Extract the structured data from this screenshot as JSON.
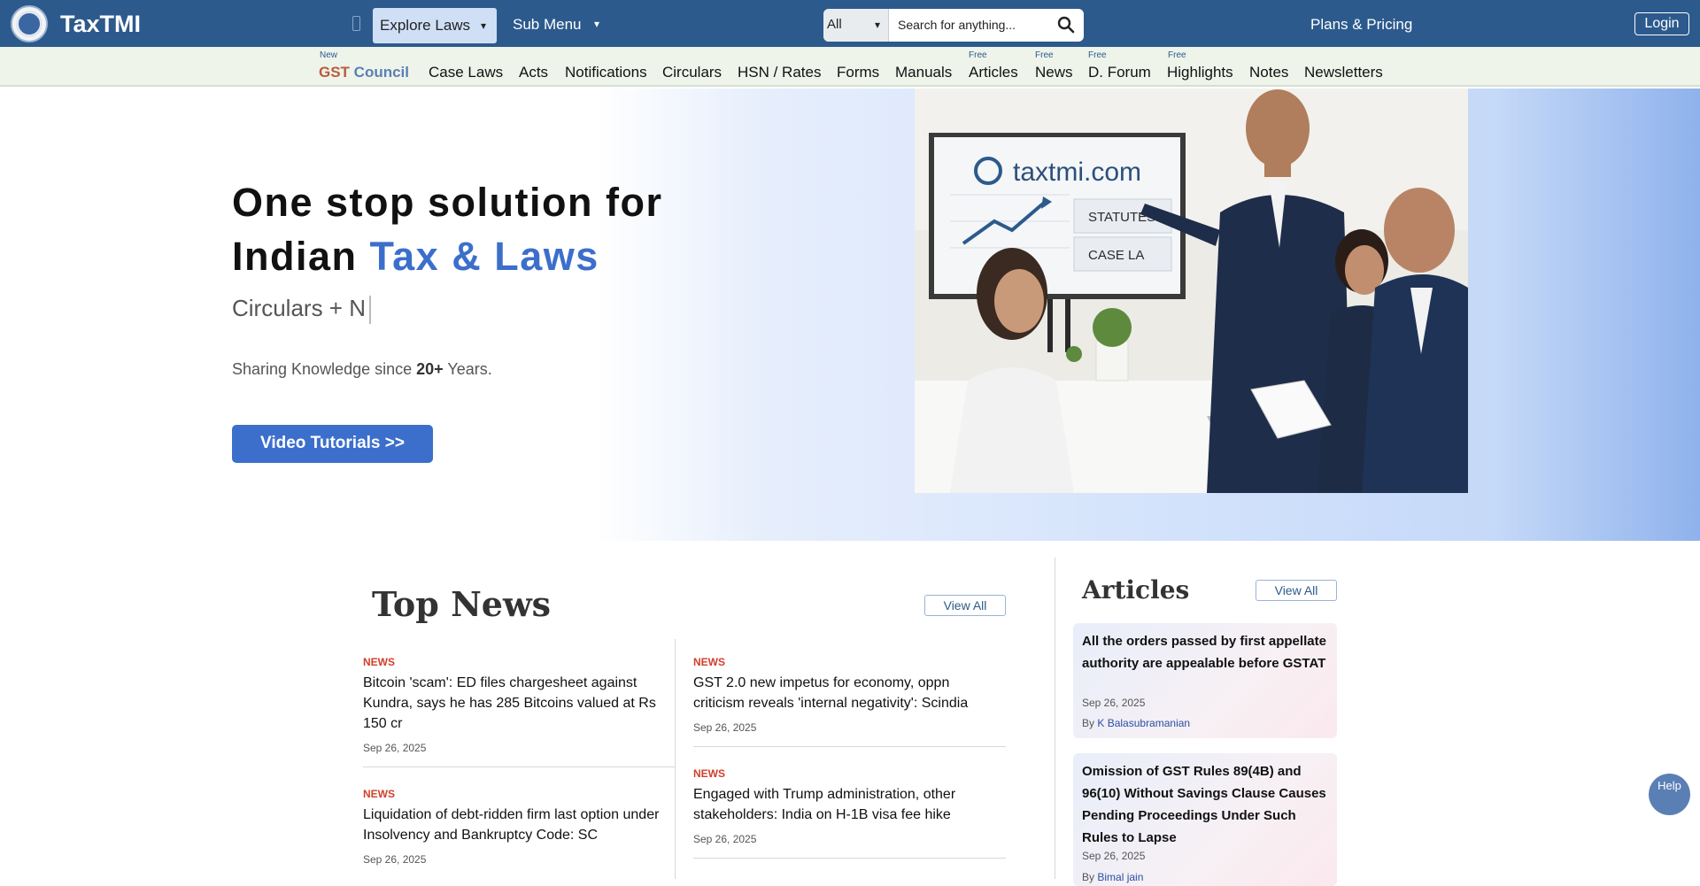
{
  "header": {
    "brand": "TaxTMI",
    "menu_glyph": "",
    "explore_label": "Explore Laws",
    "caret": "▾",
    "submenu_label": "Sub Menu",
    "search": {
      "scope": "All",
      "placeholder": "Search for anything..."
    },
    "plans_label": "Plans & Pricing ",
    "login_label": "Login"
  },
  "subnav": {
    "items": [
      {
        "tag": "New",
        "label": "GST Council",
        "accent_colors": [
          "#b85c3c",
          "#2c5a8c"
        ]
      },
      {
        "tag": "",
        "label": "Case Laws"
      },
      {
        "tag": "",
        "label": "Acts"
      },
      {
        "tag": "",
        "label": "Notifications"
      },
      {
        "tag": "",
        "label": "Circulars"
      },
      {
        "tag": "",
        "label": "HSN / Rates"
      },
      {
        "tag": "",
        "label": "Forms"
      },
      {
        "tag": "",
        "label": "Manuals"
      },
      {
        "tag": "Free",
        "label": "Articles"
      },
      {
        "tag": "Free",
        "label": "News"
      },
      {
        "tag": "Free",
        "label": "D. Forum"
      },
      {
        "tag": "Free",
        "label": "Highlights"
      },
      {
        "tag": "",
        "label": "Notes"
      },
      {
        "tag": "",
        "label": "Newsletters"
      }
    ]
  },
  "hero": {
    "line1": "One stop solution for",
    "line2_plain": "Indian ",
    "line2_accent": "Tax & Laws",
    "typed_text": "Circulars + N",
    "since_prefix": "Sharing Knowledge since ",
    "since_bold": "20+",
    "since_suffix": " Years.",
    "video_button": "Video Tutorials >>",
    "board_url": "taxtmi.com",
    "board_items": [
      "STATUTES",
      "CASE LA"
    ]
  },
  "top_news": {
    "title": "Top News",
    "view_all": "View All ",
    "items": [
      {
        "tag": " NEWS",
        "title": "Bitcoin 'scam': ED files chargesheet against Kundra, says he has 285 Bitcoins valued at Rs 150 cr",
        "date": "Sep 26, 2025"
      },
      {
        "tag": " NEWS",
        "title": "GST 2.0 new impetus for economy, oppn criticism reveals 'internal negativity': Scindia",
        "date": "Sep 26, 2025"
      },
      {
        "tag": " NEWS",
        "title": "Liquidation of debt-ridden firm last option under Insolvency and Bankruptcy Code: SC",
        "date": "Sep 26, 2025"
      },
      {
        "tag": " NEWS",
        "title": "Engaged with Trump administration, other stakeholders: India on H-1B visa fee hike",
        "date": "Sep 26, 2025"
      }
    ]
  },
  "articles": {
    "title": "Articles",
    "view_all": "View All ",
    "items": [
      {
        "title": "All the orders passed by first appellate authority are appealable before GSTAT",
        "date": "Sep 26, 2025",
        "by": "By",
        "author": "K Balasubramanian"
      },
      {
        "title": "Omission of GST Rules 89(4B) and 96(10) Without Savings Clause Causes Pending Proceedings Under Such Rules to Lapse",
        "date": "Sep 26, 2025",
        "by": "By",
        "author": "Bimal jain"
      }
    ]
  },
  "help": {
    "icon": "",
    "label": "Help"
  },
  "colors": {
    "topbar": "#2c5a8c",
    "accent": "#3c6fcb",
    "news_tag": "#d0402a"
  }
}
